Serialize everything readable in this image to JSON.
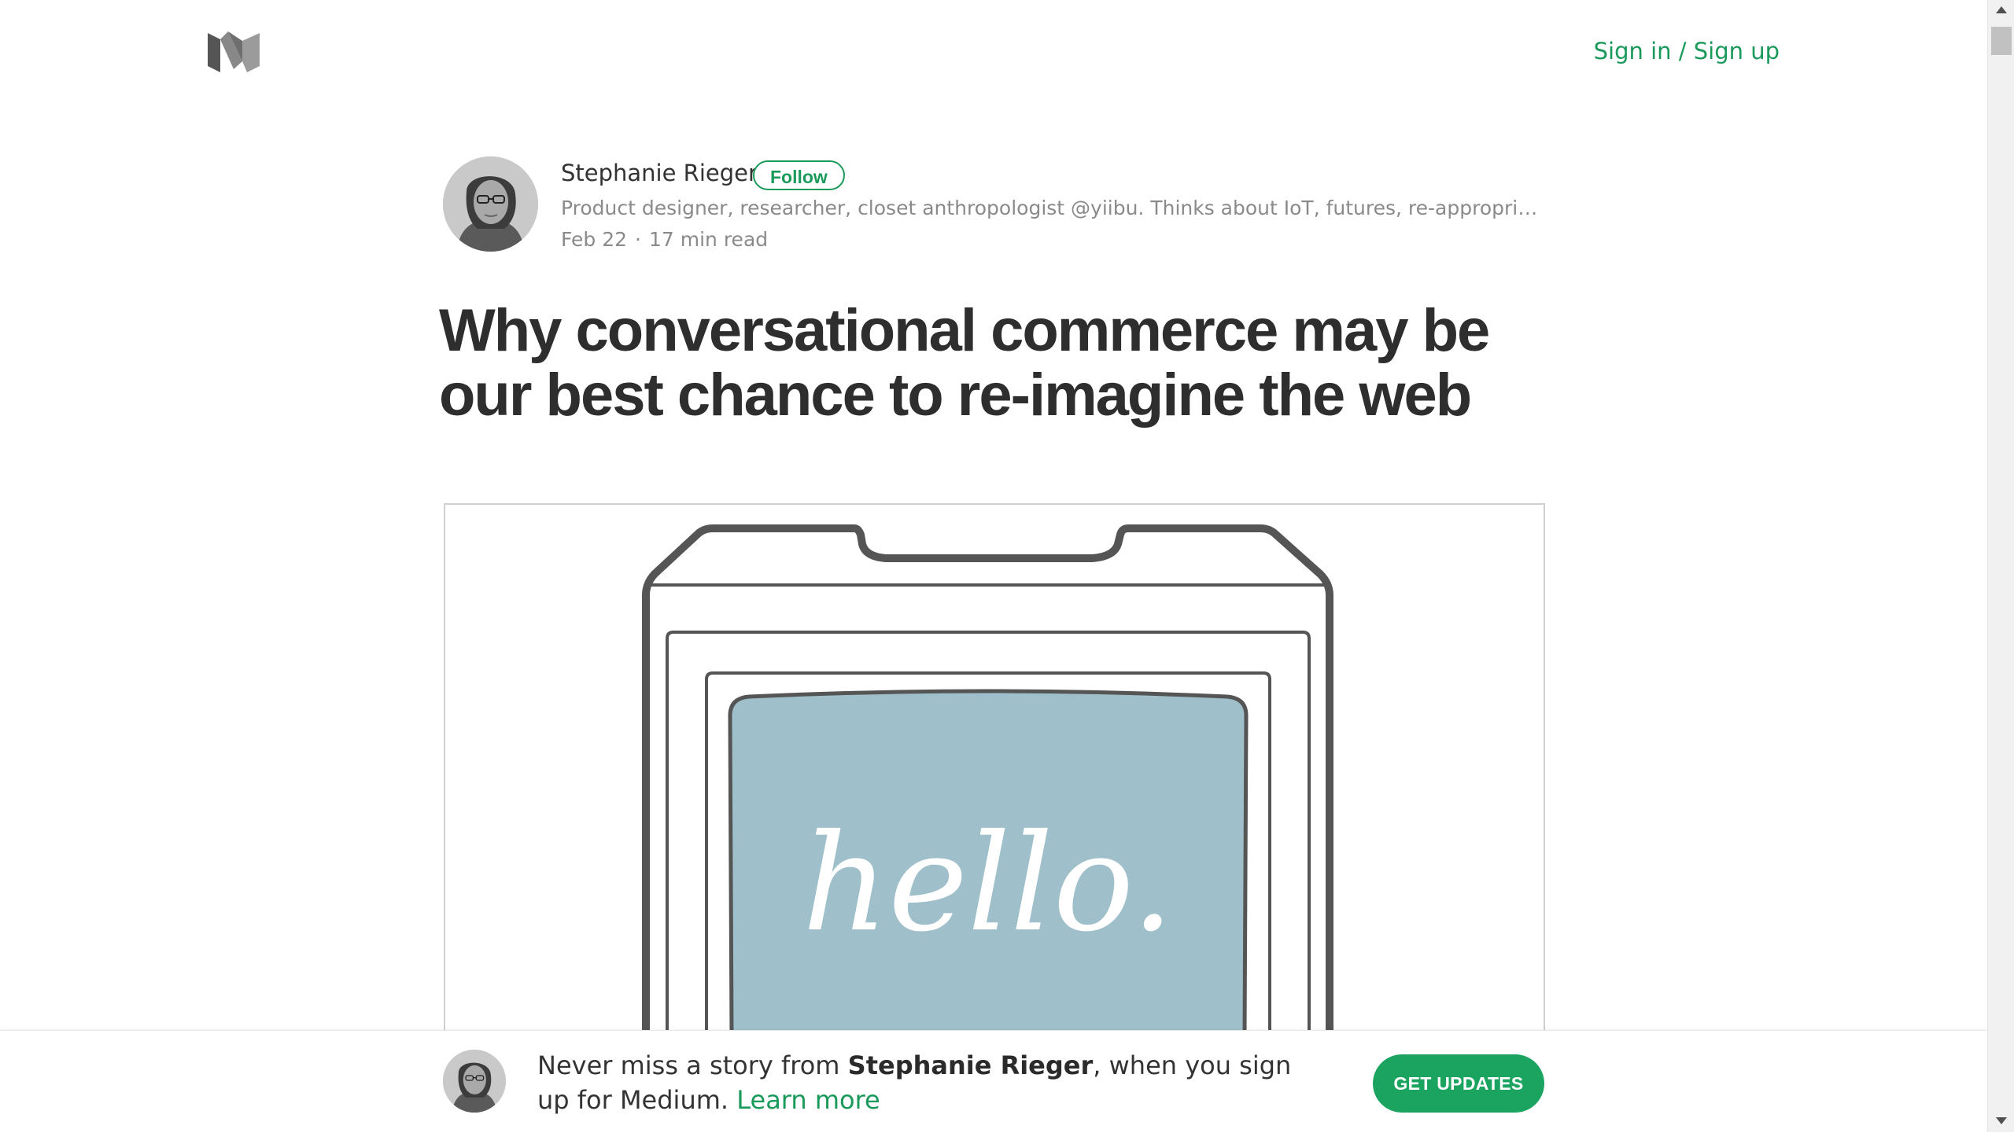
{
  "header": {
    "logo_icon": "medium-logo-icon",
    "signin_label": "Sign in / Sign up"
  },
  "author": {
    "name": "Stephanie Rieger",
    "follow_label": "Follow",
    "bio": "Product designer, researcher, closet anthropologist @yiibu. Thinks about IoT, futures, re-appropriations of t…",
    "date": "Feb 22",
    "separator": "·",
    "read_time": "17 min read"
  },
  "article": {
    "title": "Why conversational commerce may be our best chance to re-imagine the web",
    "hero_screen_text": "hello."
  },
  "banner": {
    "text_prefix": "Never miss a story from ",
    "author_name": "Stephanie Rieger",
    "text_suffix": ", when you sign up for Medium.",
    "learn_more": "Learn more",
    "cta_label": "GET UPDATES"
  },
  "colors": {
    "accent_green": "#1a9a5a",
    "cta_green": "#1aa45f",
    "screen_blue": "#9fc0ca",
    "text_dark": "#2e2e2e",
    "text_muted": "#8a8a8a"
  }
}
